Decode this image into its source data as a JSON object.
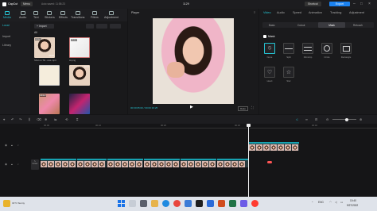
{
  "titlebar": {
    "app": "CapCut",
    "menu": "Menu",
    "autosave": "Auto saved: 11:58:23",
    "project": "1129",
    "shortcut": "Shortcut",
    "export": "Export"
  },
  "toolbar": {
    "items": [
      {
        "label": "Media",
        "active": true
      },
      {
        "label": "Audio"
      },
      {
        "label": "Text"
      },
      {
        "label": "Stickers"
      },
      {
        "label": "Effects"
      },
      {
        "label": "Transitions"
      },
      {
        "label": "Filters"
      },
      {
        "label": "Adjustment"
      }
    ]
  },
  "media": {
    "side": [
      "Local",
      "Import",
      "Library"
    ],
    "all_label": "All",
    "import_label": "Import",
    "thumbs": [
      {
        "cap": "Shot on Tik...ews.mp4",
        "badge": "Added",
        "dur": "00:22"
      },
      {
        "cap": "Hi.png",
        "badge": "Added",
        "dur": ""
      },
      {
        "cap": "",
        "badge": "",
        "dur": ""
      },
      {
        "cap": "",
        "badge": "",
        "dur": "00:10"
      },
      {
        "cap": "",
        "badge": "Added",
        "dur": ""
      },
      {
        "cap": "",
        "badge": "",
        "dur": ""
      }
    ]
  },
  "player": {
    "title": "Player",
    "time": "00:00:05:00 / 00:00:16:25",
    "ratio": "Ratio"
  },
  "props": {
    "tabs": [
      "Video",
      "Audio",
      "Speed",
      "Animation",
      "Tracking",
      "Adjustment"
    ],
    "subtabs": [
      "Basic",
      "Cutout",
      "Mask",
      "Retouch"
    ],
    "mask_title": "Mask",
    "masks": [
      "None",
      "Split",
      "Filmstrip",
      "Circle",
      "Rectangle",
      "Heart",
      "Star"
    ]
  },
  "timeline": {
    "times": [
      "00:00",
      "00:10",
      "00:20",
      "00:30",
      "00:40"
    ],
    "main_clips": [
      {
        "label": "Shot on Tik...ews.mp4  00:00:02:20"
      },
      {
        "label": "Shot on Tik 00:00:01:10"
      },
      {
        "label": "Shot on Tik 00:00:01:10"
      },
      {
        "label": "Shot on Tik 00:00:01:10"
      },
      {
        "label": "Shot on Tik 00:00:01:10"
      },
      {
        "label": "Shot on Tik 00:00:01:10"
      }
    ],
    "overlay_clip": {
      "label": "Hi.png  00:00:03:20"
    },
    "cover": "Cover"
  },
  "taskbar": {
    "weather": "31°C Sunny",
    "time": "10:40",
    "date": "9/27/2022",
    "lang": "ENG"
  },
  "colors": {
    "accent": "#25c5d4",
    "clip": "#17a2b1",
    "export": "#1b82f0"
  }
}
